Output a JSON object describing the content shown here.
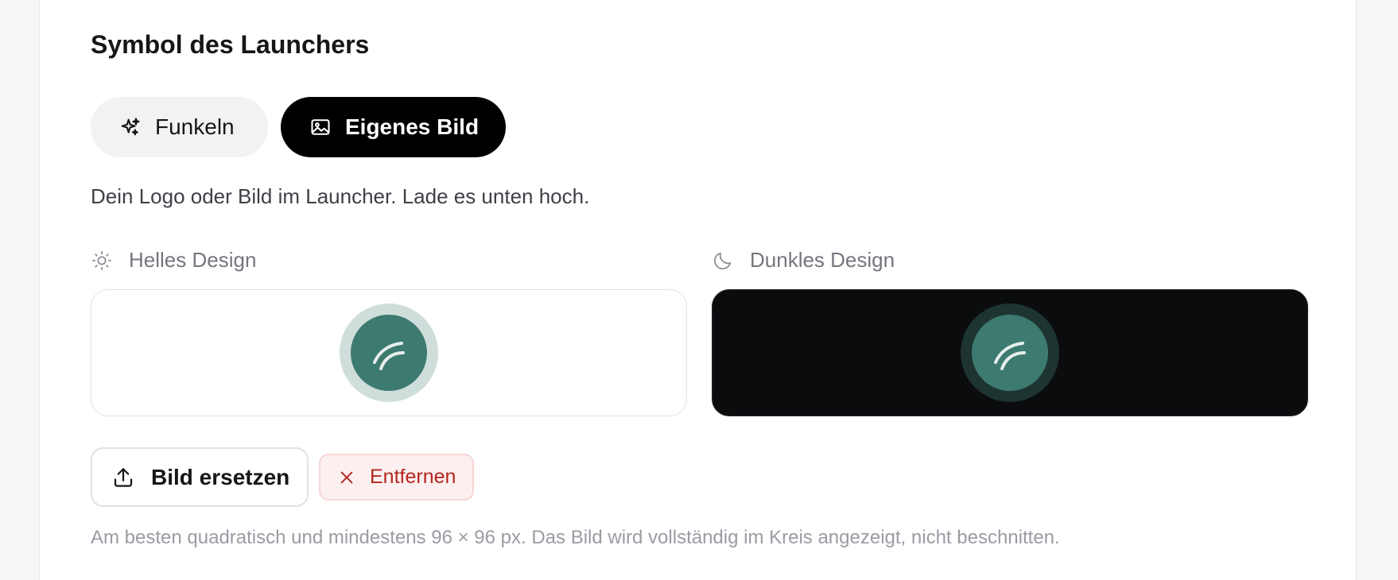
{
  "section": {
    "title": "Symbol des Launchers",
    "description": "Dein Logo oder Bild im Launcher. Lade es unten hoch.",
    "hint": "Am besten quadratisch und mindestens 96 × 96 px. Das Bild wird vollständig im Kreis angezeigt, nicht beschnitten."
  },
  "segmented": {
    "selected": "custom",
    "options": [
      {
        "label": "Funkeln",
        "icon": "sparkles-icon"
      },
      {
        "label": "Eigenes Bild",
        "icon": "image-icon"
      }
    ]
  },
  "previews": {
    "light": {
      "label": "Helles Design",
      "icon": "sun-icon",
      "background": "#ffffff"
    },
    "dark": {
      "label": "Dunkles Design",
      "icon": "moon-icon",
      "background": "#0b0c0e"
    }
  },
  "actions": {
    "replace_label": "Bild ersetzen",
    "remove_label": "Entfernen"
  },
  "colors": {
    "accent": "#000000",
    "launcher_green": "#3d7a6f",
    "danger": "#b3261e"
  }
}
